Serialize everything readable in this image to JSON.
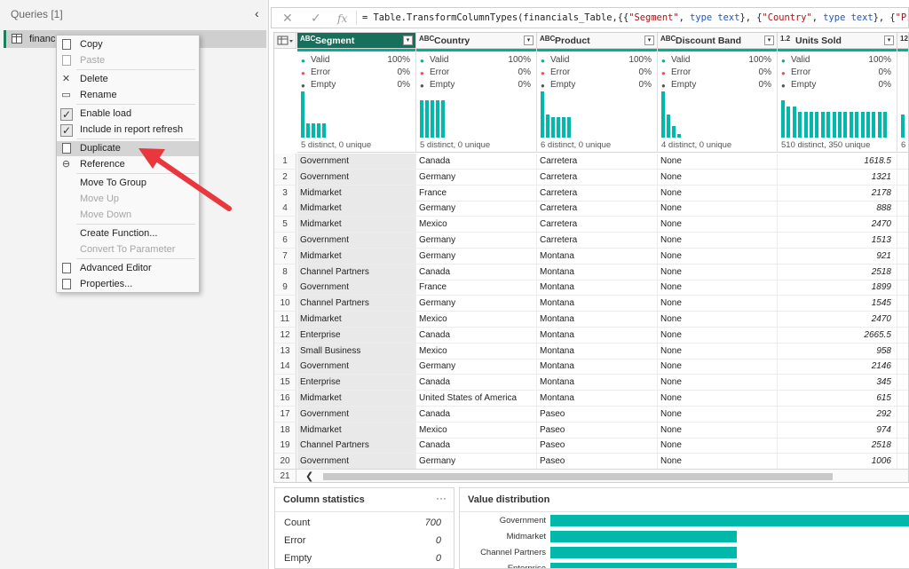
{
  "queries": {
    "header": "Queries [1]",
    "collapse_glyph": "‹",
    "item_label": "financials_Table"
  },
  "context_menu": {
    "items": [
      {
        "label": "Copy",
        "icon": "copy-icon",
        "disabled": false
      },
      {
        "label": "Paste",
        "icon": "paste-icon",
        "disabled": true
      },
      {
        "label": "Delete",
        "icon": "delete-icon",
        "disabled": false
      },
      {
        "label": "Rename",
        "icon": "rename-icon",
        "disabled": false
      },
      {
        "label": "Enable load",
        "icon": "check-icon",
        "disabled": false,
        "checked": true
      },
      {
        "label": "Include in report refresh",
        "icon": "check-icon",
        "disabled": false,
        "checked": true
      },
      {
        "label": "Duplicate",
        "icon": "duplicate-icon",
        "disabled": false,
        "hovered": true
      },
      {
        "label": "Reference",
        "icon": "reference-icon",
        "disabled": false
      },
      {
        "label": "Move To Group",
        "icon": "",
        "disabled": false
      },
      {
        "label": "Move Up",
        "icon": "",
        "disabled": true
      },
      {
        "label": "Move Down",
        "icon": "",
        "disabled": true
      },
      {
        "label": "Create Function...",
        "icon": "",
        "disabled": false
      },
      {
        "label": "Convert To Parameter",
        "icon": "",
        "disabled": true
      },
      {
        "label": "Advanced Editor",
        "icon": "advanced-editor-icon",
        "disabled": false
      },
      {
        "label": "Properties...",
        "icon": "properties-icon",
        "disabled": false
      }
    ]
  },
  "formula_bar": {
    "cancel_glyph": "✕",
    "confirm_glyph": "✓",
    "fx_glyph": "fx",
    "formula": "= Table.TransformColumnTypes(financials_Table,{{\"Segment\", type text}, {\"Country\", type text}, {\"Product\", type"
  },
  "columns": [
    {
      "name": "Segment",
      "type_icon": "ABC",
      "selected": true,
      "valid": "100%",
      "error": "0%",
      "empty": "0%",
      "distinct": "5 distinct, 0 unique",
      "bars": [
        60,
        18,
        18,
        18,
        18
      ]
    },
    {
      "name": "Country",
      "type_icon": "ABC",
      "selected": false,
      "valid": "100%",
      "error": "0%",
      "empty": "0%",
      "distinct": "5 distinct, 0 unique",
      "bars": [
        48,
        48,
        48,
        48,
        48
      ]
    },
    {
      "name": "Product",
      "type_icon": "ABC",
      "selected": false,
      "valid": "100%",
      "error": "0%",
      "empty": "0%",
      "distinct": "6 distinct, 0 unique",
      "bars": [
        60,
        30,
        26,
        26,
        26,
        26
      ]
    },
    {
      "name": "Discount Band",
      "type_icon": "ABC",
      "selected": false,
      "valid": "100%",
      "error": "0%",
      "empty": "0%",
      "distinct": "4 distinct, 0 unique",
      "bars": [
        60,
        30,
        15,
        5
      ]
    },
    {
      "name": "Units Sold",
      "type_icon": "1.2",
      "selected": false,
      "valid": "100%",
      "error": "0%",
      "empty": "0%",
      "distinct": "510 distinct, 350 unique",
      "bars": [
        48,
        40,
        40,
        34,
        34,
        34,
        34,
        34,
        34,
        34,
        34,
        34,
        34,
        34,
        34,
        34,
        34,
        34,
        34
      ]
    },
    {
      "name": "",
      "type_icon": "123",
      "selected": false,
      "valid": "",
      "error": "",
      "empty": "",
      "distinct": "6",
      "bars": [
        30
      ]
    }
  ],
  "stat_labels": {
    "valid": "Valid",
    "error": "Error",
    "empty": "Empty"
  },
  "rows": [
    {
      "n": "1",
      "segment": "Government",
      "country": "Canada",
      "product": "Carretera",
      "discount": "None",
      "units": "1618.5"
    },
    {
      "n": "2",
      "segment": "Government",
      "country": "Germany",
      "product": "Carretera",
      "discount": "None",
      "units": "1321"
    },
    {
      "n": "3",
      "segment": "Midmarket",
      "country": "France",
      "product": "Carretera",
      "discount": "None",
      "units": "2178"
    },
    {
      "n": "4",
      "segment": "Midmarket",
      "country": "Germany",
      "product": "Carretera",
      "discount": "None",
      "units": "888"
    },
    {
      "n": "5",
      "segment": "Midmarket",
      "country": "Mexico",
      "product": "Carretera",
      "discount": "None",
      "units": "2470"
    },
    {
      "n": "6",
      "segment": "Government",
      "country": "Germany",
      "product": "Carretera",
      "discount": "None",
      "units": "1513"
    },
    {
      "n": "7",
      "segment": "Midmarket",
      "country": "Germany",
      "product": "Montana",
      "discount": "None",
      "units": "921"
    },
    {
      "n": "8",
      "segment": "Channel Partners",
      "country": "Canada",
      "product": "Montana",
      "discount": "None",
      "units": "2518"
    },
    {
      "n": "9",
      "segment": "Government",
      "country": "France",
      "product": "Montana",
      "discount": "None",
      "units": "1899"
    },
    {
      "n": "10",
      "segment": "Channel Partners",
      "country": "Germany",
      "product": "Montana",
      "discount": "None",
      "units": "1545"
    },
    {
      "n": "11",
      "segment": "Midmarket",
      "country": "Mexico",
      "product": "Montana",
      "discount": "None",
      "units": "2470"
    },
    {
      "n": "12",
      "segment": "Enterprise",
      "country": "Canada",
      "product": "Montana",
      "discount": "None",
      "units": "2665.5"
    },
    {
      "n": "13",
      "segment": "Small Business",
      "country": "Mexico",
      "product": "Montana",
      "discount": "None",
      "units": "958"
    },
    {
      "n": "14",
      "segment": "Government",
      "country": "Germany",
      "product": "Montana",
      "discount": "None",
      "units": "2146"
    },
    {
      "n": "15",
      "segment": "Enterprise",
      "country": "Canada",
      "product": "Montana",
      "discount": "None",
      "units": "345"
    },
    {
      "n": "16",
      "segment": "Midmarket",
      "country": "United States of America",
      "product": "Montana",
      "discount": "None",
      "units": "615"
    },
    {
      "n": "17",
      "segment": "Government",
      "country": "Canada",
      "product": "Paseo",
      "discount": "None",
      "units": "292"
    },
    {
      "n": "18",
      "segment": "Midmarket",
      "country": "Mexico",
      "product": "Paseo",
      "discount": "None",
      "units": "974"
    },
    {
      "n": "19",
      "segment": "Channel Partners",
      "country": "Canada",
      "product": "Paseo",
      "discount": "None",
      "units": "2518"
    },
    {
      "n": "20",
      "segment": "Government",
      "country": "Germany",
      "product": "Paseo",
      "discount": "None",
      "units": "1006"
    }
  ],
  "scroll_row_label": "21",
  "column_statistics": {
    "title": "Column statistics",
    "more_glyph": "···",
    "items": [
      {
        "label": "Count",
        "value": "700"
      },
      {
        "label": "Error",
        "value": "0"
      },
      {
        "label": "Empty",
        "value": "0"
      }
    ]
  },
  "value_distribution": {
    "title": "Value distribution",
    "items": [
      {
        "label": "Government",
        "share": 1.0
      },
      {
        "label": "Midmarket",
        "share": 0.5
      },
      {
        "label": "Channel Partners",
        "share": 0.5
      },
      {
        "label": "Enterprise",
        "share": 0.5
      }
    ]
  },
  "colors": {
    "accent": "#17705b",
    "teal": "#01b8aa",
    "valid_dot": "#00b294",
    "error_dot": "#e8565b",
    "empty_dot": "#555555",
    "arrow": "#e8383d"
  }
}
